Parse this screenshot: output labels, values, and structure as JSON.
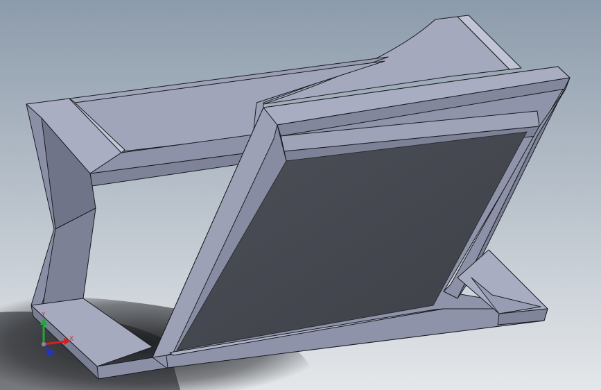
{
  "viewport": {
    "background_top": "#8c9bab",
    "background_bottom": "#e4e7ea",
    "shadow_color": "#1c1d20"
  },
  "model": {
    "colors": {
      "face_light": "#a6abc0",
      "face_top": "#9da2b8",
      "face_mid": "#8c91a7",
      "face_dark": "#6f7488",
      "face_side": "#7a7f94",
      "panel": "#45484f",
      "panel_edge": "#2a2c31",
      "edge": "#1a1b20"
    }
  },
  "triad": {
    "x_label": "X",
    "y_label": "Y",
    "x_color": "#d42020",
    "y_color": "#1fa83a",
    "z_color": "#2136b8",
    "label_color": "#c23030"
  }
}
